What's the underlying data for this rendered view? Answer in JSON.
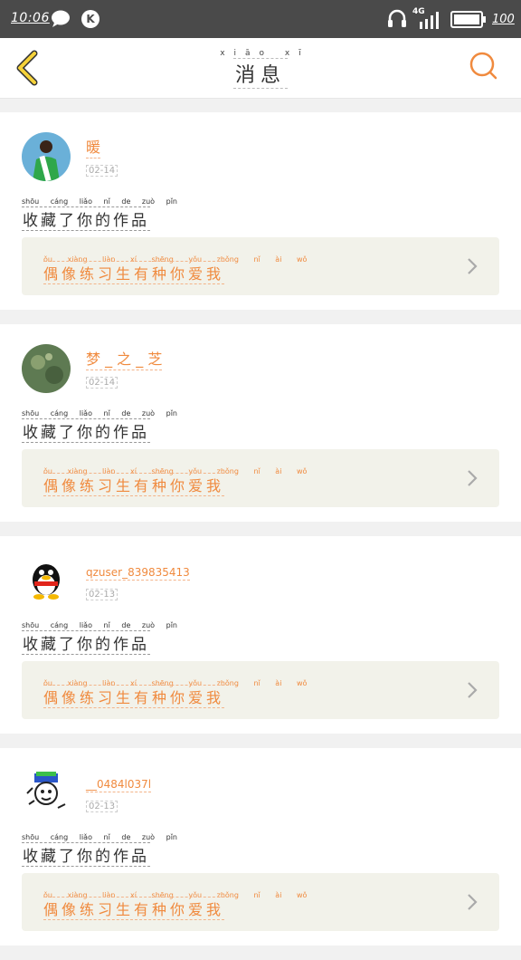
{
  "status_bar": {
    "time": "10:06",
    "network": "4G",
    "battery": "100"
  },
  "header": {
    "title_pinyin": "xiāo xī",
    "title": "消息"
  },
  "colors": {
    "accent": "#f08a3e",
    "back_arrow": "#f5d23a",
    "card_box": "#f2f2ea"
  },
  "messages": [
    {
      "user": "暖 ",
      "time": "02-14",
      "action_pinyin": "shōu cáng liǎo nǐ de zuò pǐn",
      "action": "收藏了你的作品",
      "work_pinyin": "ǒu xiàng liàn xí shēng yǒu zhǒng nǐ ài wǒ",
      "work": "偶像练习生有种你爱我"
    },
    {
      "user": "梦 _ 之 _ 芝",
      "time": "02-14",
      "action_pinyin": "shōu cáng liǎo nǐ de zuò pǐn",
      "action": "收藏了你的作品",
      "work_pinyin": "ǒu xiàng liàn xí shēng yǒu zhǒng nǐ ài wǒ",
      "work": "偶像练习生有种你爱我"
    },
    {
      "user": "qzuser_839835413",
      "time": "02-13",
      "action_pinyin": "shōu cáng liǎo nǐ de zuò pǐn",
      "action": "收藏了你的作品",
      "work_pinyin": "ǒu xiàng liàn xí shēng yǒu zhǒng nǐ ài wǒ",
      "work": "偶像练习生有种你爱我"
    },
    {
      "user": "__0484l037l",
      "time": "02-13",
      "action_pinyin": "shōu cáng liǎo nǐ de zuò pǐn",
      "action": "收藏了你的作品",
      "work_pinyin": "ǒu xiàng liàn xí shēng yǒu zhǒng nǐ ài wǒ",
      "work": "偶像练习生有种你爱我"
    }
  ],
  "icons": [
    "chat-bubble-icon",
    "k-app-icon",
    "headset-icon",
    "signal-icon",
    "battery-icon",
    "back-arrow-icon",
    "search-icon",
    "chevron-right-icon"
  ]
}
